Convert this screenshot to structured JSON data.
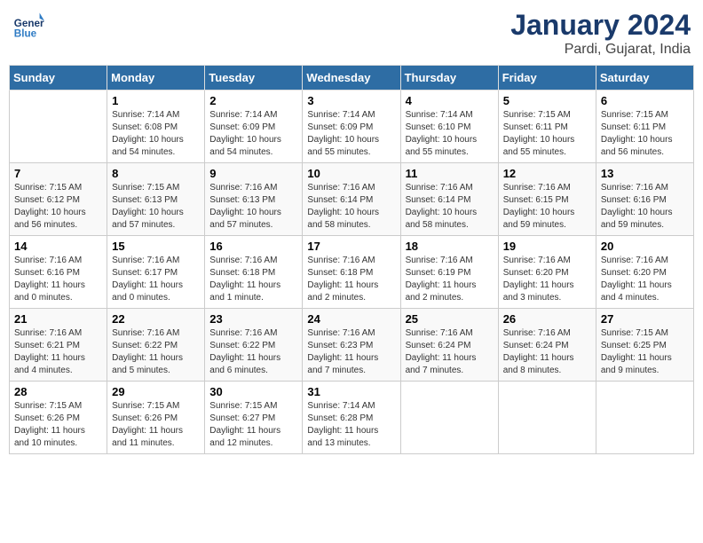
{
  "header": {
    "logo_line1": "General",
    "logo_line2": "Blue",
    "month": "January 2024",
    "location": "Pardi, Gujarat, India"
  },
  "weekdays": [
    "Sunday",
    "Monday",
    "Tuesday",
    "Wednesday",
    "Thursday",
    "Friday",
    "Saturday"
  ],
  "weeks": [
    [
      {
        "day": "",
        "text": ""
      },
      {
        "day": "1",
        "text": "Sunrise: 7:14 AM\nSunset: 6:08 PM\nDaylight: 10 hours\nand 54 minutes."
      },
      {
        "day": "2",
        "text": "Sunrise: 7:14 AM\nSunset: 6:09 PM\nDaylight: 10 hours\nand 54 minutes."
      },
      {
        "day": "3",
        "text": "Sunrise: 7:14 AM\nSunset: 6:09 PM\nDaylight: 10 hours\nand 55 minutes."
      },
      {
        "day": "4",
        "text": "Sunrise: 7:14 AM\nSunset: 6:10 PM\nDaylight: 10 hours\nand 55 minutes."
      },
      {
        "day": "5",
        "text": "Sunrise: 7:15 AM\nSunset: 6:11 PM\nDaylight: 10 hours\nand 55 minutes."
      },
      {
        "day": "6",
        "text": "Sunrise: 7:15 AM\nSunset: 6:11 PM\nDaylight: 10 hours\nand 56 minutes."
      }
    ],
    [
      {
        "day": "7",
        "text": "Sunrise: 7:15 AM\nSunset: 6:12 PM\nDaylight: 10 hours\nand 56 minutes."
      },
      {
        "day": "8",
        "text": "Sunrise: 7:15 AM\nSunset: 6:13 PM\nDaylight: 10 hours\nand 57 minutes."
      },
      {
        "day": "9",
        "text": "Sunrise: 7:16 AM\nSunset: 6:13 PM\nDaylight: 10 hours\nand 57 minutes."
      },
      {
        "day": "10",
        "text": "Sunrise: 7:16 AM\nSunset: 6:14 PM\nDaylight: 10 hours\nand 58 minutes."
      },
      {
        "day": "11",
        "text": "Sunrise: 7:16 AM\nSunset: 6:14 PM\nDaylight: 10 hours\nand 58 minutes."
      },
      {
        "day": "12",
        "text": "Sunrise: 7:16 AM\nSunset: 6:15 PM\nDaylight: 10 hours\nand 59 minutes."
      },
      {
        "day": "13",
        "text": "Sunrise: 7:16 AM\nSunset: 6:16 PM\nDaylight: 10 hours\nand 59 minutes."
      }
    ],
    [
      {
        "day": "14",
        "text": "Sunrise: 7:16 AM\nSunset: 6:16 PM\nDaylight: 11 hours\nand 0 minutes."
      },
      {
        "day": "15",
        "text": "Sunrise: 7:16 AM\nSunset: 6:17 PM\nDaylight: 11 hours\nand 0 minutes."
      },
      {
        "day": "16",
        "text": "Sunrise: 7:16 AM\nSunset: 6:18 PM\nDaylight: 11 hours\nand 1 minute."
      },
      {
        "day": "17",
        "text": "Sunrise: 7:16 AM\nSunset: 6:18 PM\nDaylight: 11 hours\nand 2 minutes."
      },
      {
        "day": "18",
        "text": "Sunrise: 7:16 AM\nSunset: 6:19 PM\nDaylight: 11 hours\nand 2 minutes."
      },
      {
        "day": "19",
        "text": "Sunrise: 7:16 AM\nSunset: 6:20 PM\nDaylight: 11 hours\nand 3 minutes."
      },
      {
        "day": "20",
        "text": "Sunrise: 7:16 AM\nSunset: 6:20 PM\nDaylight: 11 hours\nand 4 minutes."
      }
    ],
    [
      {
        "day": "21",
        "text": "Sunrise: 7:16 AM\nSunset: 6:21 PM\nDaylight: 11 hours\nand 4 minutes."
      },
      {
        "day": "22",
        "text": "Sunrise: 7:16 AM\nSunset: 6:22 PM\nDaylight: 11 hours\nand 5 minutes."
      },
      {
        "day": "23",
        "text": "Sunrise: 7:16 AM\nSunset: 6:22 PM\nDaylight: 11 hours\nand 6 minutes."
      },
      {
        "day": "24",
        "text": "Sunrise: 7:16 AM\nSunset: 6:23 PM\nDaylight: 11 hours\nand 7 minutes."
      },
      {
        "day": "25",
        "text": "Sunrise: 7:16 AM\nSunset: 6:24 PM\nDaylight: 11 hours\nand 7 minutes."
      },
      {
        "day": "26",
        "text": "Sunrise: 7:16 AM\nSunset: 6:24 PM\nDaylight: 11 hours\nand 8 minutes."
      },
      {
        "day": "27",
        "text": "Sunrise: 7:15 AM\nSunset: 6:25 PM\nDaylight: 11 hours\nand 9 minutes."
      }
    ],
    [
      {
        "day": "28",
        "text": "Sunrise: 7:15 AM\nSunset: 6:26 PM\nDaylight: 11 hours\nand 10 minutes."
      },
      {
        "day": "29",
        "text": "Sunrise: 7:15 AM\nSunset: 6:26 PM\nDaylight: 11 hours\nand 11 minutes."
      },
      {
        "day": "30",
        "text": "Sunrise: 7:15 AM\nSunset: 6:27 PM\nDaylight: 11 hours\nand 12 minutes."
      },
      {
        "day": "31",
        "text": "Sunrise: 7:14 AM\nSunset: 6:28 PM\nDaylight: 11 hours\nand 13 minutes."
      },
      {
        "day": "",
        "text": ""
      },
      {
        "day": "",
        "text": ""
      },
      {
        "day": "",
        "text": ""
      }
    ]
  ]
}
